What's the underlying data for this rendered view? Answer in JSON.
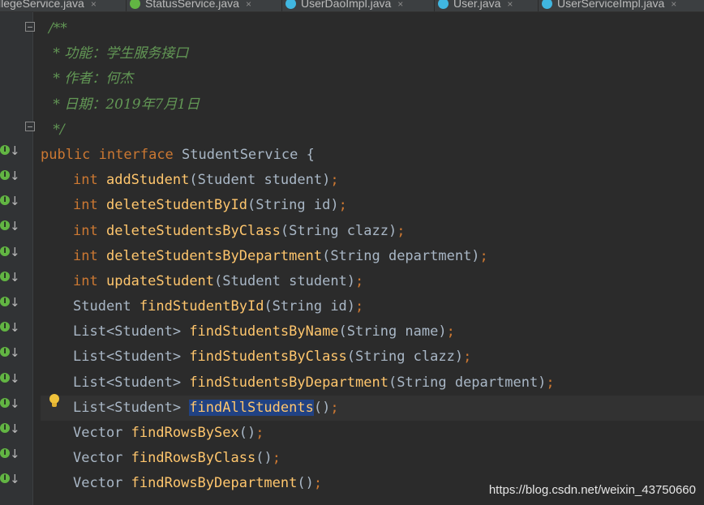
{
  "tabs": [
    {
      "label": "llegeService.java",
      "icon": "class-icon"
    },
    {
      "label": "StatusService.java",
      "icon": "interface-icon"
    },
    {
      "label": "UserDaoImpl.java",
      "icon": "class-icon"
    },
    {
      "label": "User.java",
      "icon": "class-icon"
    },
    {
      "label": "UserServiceImpl.java",
      "icon": "class-icon"
    }
  ],
  "tab_close_glyph": "×",
  "gutter_marker": {
    "letter": "I",
    "arrow": "↓"
  },
  "comment": {
    "open": "/**",
    "func": " * 功能：学生服务接口",
    "author": " * 作者：何杰",
    "date": " * 日期：2019年7月1日",
    "close": " */"
  },
  "decl": {
    "public": "public",
    "interface": "interface",
    "name": "StudentService",
    "brace": "{"
  },
  "tokens": {
    "int": "int",
    "semi": ";"
  },
  "methods": {
    "m1": {
      "ret": "int",
      "name": "addStudent",
      "params": "(Student student)"
    },
    "m2": {
      "ret": "int",
      "name": "deleteStudentById",
      "params": "(String id)"
    },
    "m3": {
      "ret": "int",
      "name": "deleteStudentsByClass",
      "params": "(String clazz)"
    },
    "m4": {
      "ret": "int",
      "name": "deleteStudentsByDepartment",
      "params": "(String department)"
    },
    "m5": {
      "ret": "int",
      "name": "updateStudent",
      "params": "(Student student)"
    },
    "m6": {
      "ret": "Student",
      "name": "findStudentById",
      "params": "(String id)"
    },
    "m7": {
      "ret": "List<Student>",
      "name": "findStudentsByName",
      "params": "(String name)"
    },
    "m8": {
      "ret": "List<Student>",
      "name": "findStudentsByClass",
      "params": "(String clazz)"
    },
    "m9": {
      "ret": "List<Student>",
      "name": "findStudentsByDepartment",
      "params": "(String department)"
    },
    "m10": {
      "ret": "List<Student>",
      "name": "findAllStudents",
      "params": "()"
    },
    "m11": {
      "ret": "Vector",
      "name": "findRowsBySex",
      "params": "()"
    },
    "m12": {
      "ret": "Vector",
      "name": "findRowsByClass",
      "params": "()"
    },
    "m13": {
      "ret": "Vector",
      "name": "findRowsByDepartment",
      "params": "()"
    }
  },
  "watermark": "https://blog.csdn.net/weixin_43750660",
  "colors": {
    "background": "#2b2b2b",
    "keyword": "#cc7832",
    "method": "#ffc66d",
    "text": "#a9b7c6",
    "comment": "#629755",
    "selection": "#214283",
    "implemented_marker": "#62b543"
  }
}
